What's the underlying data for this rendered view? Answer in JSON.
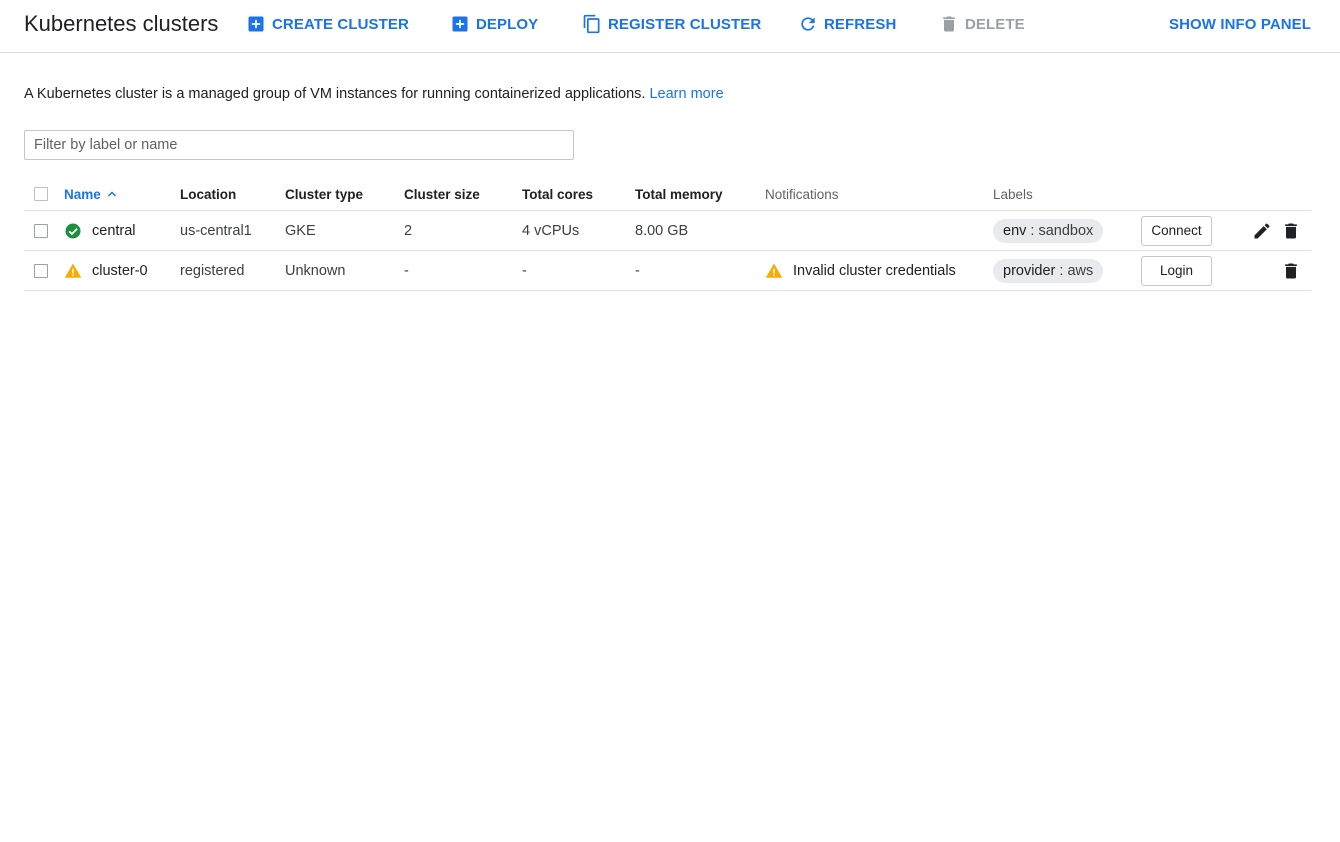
{
  "header": {
    "title": "Kubernetes clusters",
    "buttons": {
      "create": "CREATE CLUSTER",
      "deploy": "DEPLOY",
      "register": "REGISTER CLUSTER",
      "refresh": "REFRESH",
      "delete": "DELETE",
      "info": "SHOW INFO PANEL"
    },
    "icons": {
      "create": "add-box-icon",
      "deploy": "add-box-icon",
      "register": "copy-icon",
      "refresh": "refresh-icon",
      "delete": "trash-icon"
    }
  },
  "description": {
    "text": "A Kubernetes cluster is a managed group of VM instances for running containerized applications. ",
    "link": "Learn more"
  },
  "filter": {
    "placeholder": "Filter by label or name",
    "value": ""
  },
  "table": {
    "columns": {
      "name": "Name",
      "location": "Location",
      "type": "Cluster type",
      "size": "Cluster size",
      "cores": "Total cores",
      "memory": "Total memory",
      "notifications": "Notifications",
      "labels": "Labels"
    },
    "sort": {
      "column": "name",
      "direction": "ascending"
    },
    "rows": [
      {
        "status": "ok",
        "name": "central",
        "location": "us-central1",
        "type": "GKE",
        "size": "2",
        "cores": "4 vCPUs",
        "memory": "8.00 GB",
        "notification": "",
        "label_key": "env",
        "label_sep": " : ",
        "label_value": "sandbox",
        "action": "Connect",
        "editable": true
      },
      {
        "status": "warning",
        "name": "cluster-0",
        "location": "registered",
        "type": "Unknown",
        "size": "-",
        "cores": "-",
        "memory": "-",
        "notification": "Invalid cluster credentials",
        "label_key": "provider",
        "label_sep": " : ",
        "label_value": "aws",
        "action": "Login",
        "editable": false
      }
    ]
  },
  "colors": {
    "accent": "#1a73e8",
    "success": "#1e8e3e",
    "warning": "#f9ab00",
    "disabled": "#9aa0a6"
  }
}
